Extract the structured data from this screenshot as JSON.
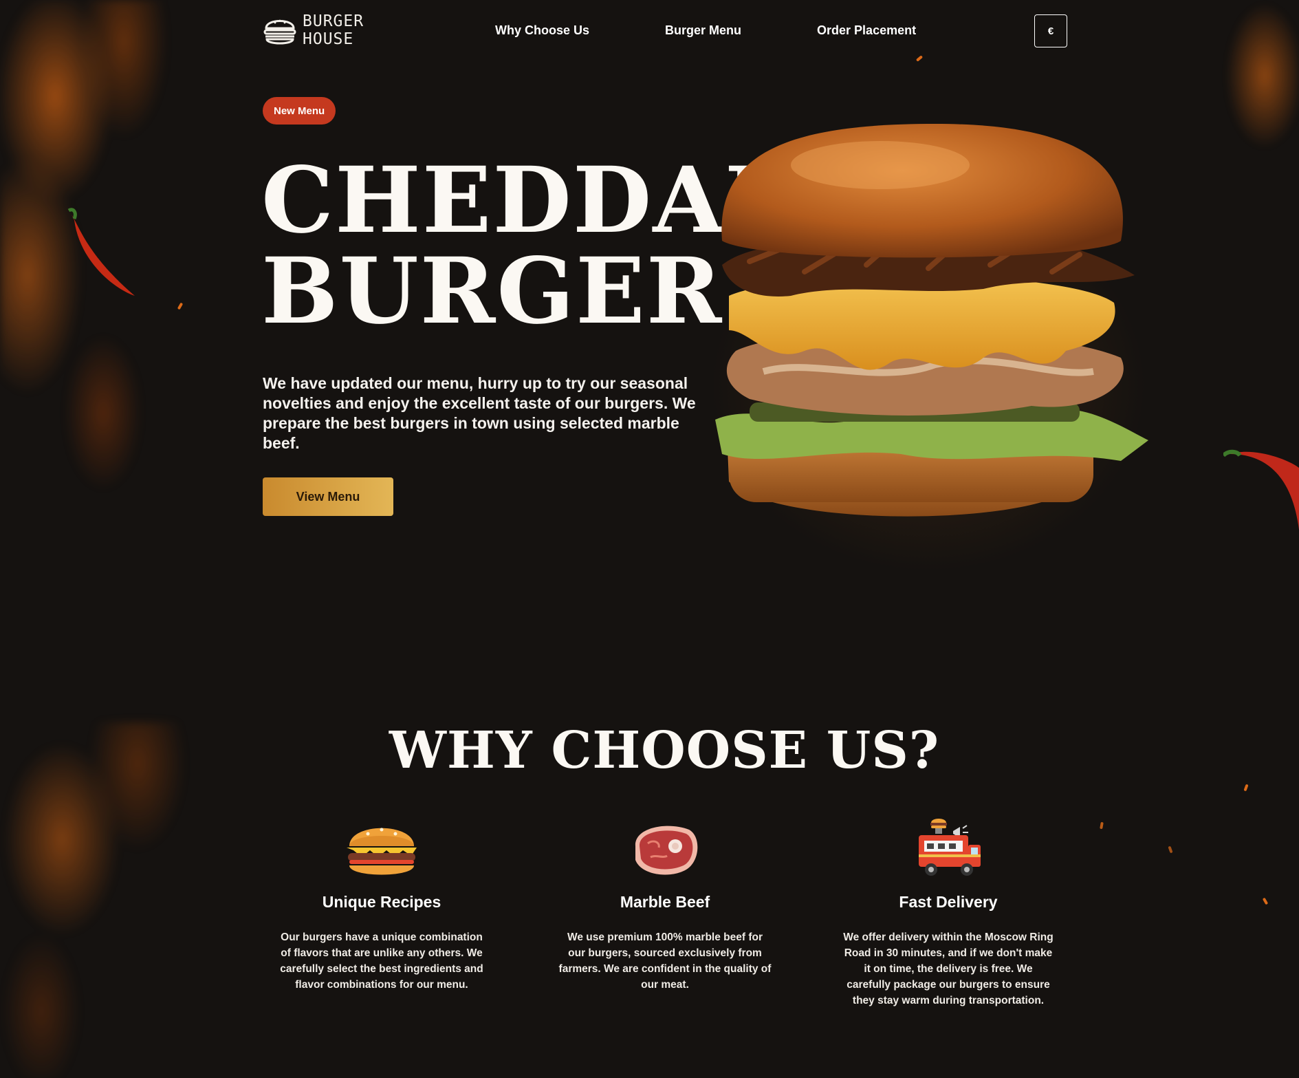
{
  "brand": {
    "line1": "BURGER",
    "line2": "HOUSE",
    "icon": "burger-icon"
  },
  "nav": {
    "items": [
      {
        "label": "Why Choose Us"
      },
      {
        "label": "Burger Menu"
      },
      {
        "label": "Order Placement"
      }
    ],
    "currency_label": "€"
  },
  "hero": {
    "badge": "New Menu",
    "title_line1": "CHEDDAR",
    "title_line2": "BURGER",
    "description": "We have updated our menu, hurry up to try our seasonal novelties and enjoy the excellent taste of our burgers. We prepare the best burgers in town using selected marble beef.",
    "cta_label": "View Menu"
  },
  "why": {
    "title": "WHY CHOOSE US?",
    "features": [
      {
        "icon": "burger-icon",
        "title": "Unique Recipes",
        "text": "Our burgers have a unique combination of flavors that are unlike any others. We carefully select the best ingredients and flavor combinations for our menu."
      },
      {
        "icon": "steak-icon",
        "title": "Marble Beef",
        "text": "We use premium 100% marble beef for our burgers, sourced exclusively from farmers. We are confident in the quality of our meat."
      },
      {
        "icon": "food-truck-icon",
        "title": "Fast Delivery",
        "text": "We offer delivery within the Moscow Ring Road in 30 minutes, and if we don't make it on time, the delivery is free. We carefully package our burgers to ensure they stay warm during transportation."
      }
    ]
  },
  "colors": {
    "background": "#151210",
    "badge": "#c5391f",
    "cta_start": "#c98a2e",
    "cta_end": "#e3b656"
  }
}
